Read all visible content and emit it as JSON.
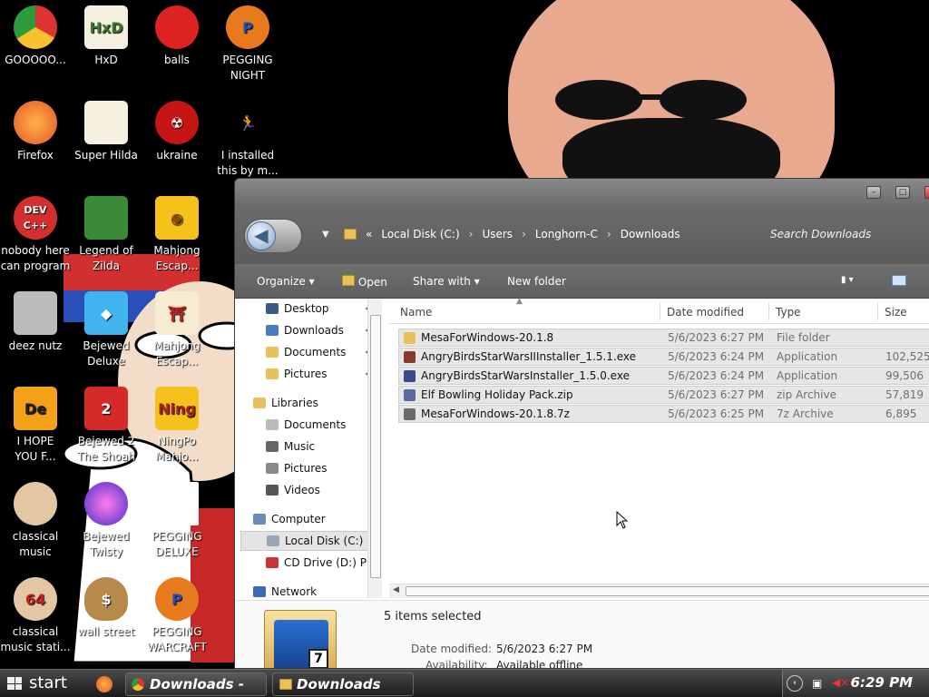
{
  "desktop": {
    "icons": [
      {
        "label": "GOOOOO...",
        "icon": "chrome-icon"
      },
      {
        "label": "HxD",
        "icon": "hxd-icon"
      },
      {
        "label": "balls",
        "icon": "red-fuzzball-icon"
      },
      {
        "label": "PEGGING\nNIGHT",
        "icon": "p-logo-icon"
      },
      {
        "label": "Firefox",
        "icon": "firefox-icon"
      },
      {
        "label": "Super Hilda",
        "icon": "pixel-character-icon"
      },
      {
        "label": "ukraine",
        "icon": "radiation-icon"
      },
      {
        "label": "I installed\nthis by m...",
        "icon": "running-man-icon"
      },
      {
        "label": "nobody here\ncan program",
        "icon": "devcpp-icon"
      },
      {
        "label": "Legend of\nZilda",
        "icon": "elf-character-icon"
      },
      {
        "label": "Mahjong\nEscap...",
        "icon": "mahjong-tile-icon"
      },
      {
        "label": "deez nutz",
        "icon": "windows-stack-icon"
      },
      {
        "label": "Bejewed\nDeluxe",
        "icon": "blue-gem-icon"
      },
      {
        "label": "Mahjong\nEscap...",
        "icon": "torii-tile-icon"
      },
      {
        "label": "I HOPE\nYOU F...",
        "icon": "de-logo-icon"
      },
      {
        "label": "Bejewed 2\nThe Shoah",
        "icon": "diamond-2-icon"
      },
      {
        "label": "NingPo\nMahjo...",
        "icon": "ningpo-tile-icon"
      },
      {
        "label": "classical\nmusic station",
        "icon": "portrait-icon"
      },
      {
        "label": "Bejewed\nTwisty",
        "icon": "gem-orb-icon"
      },
      {
        "label": "PEGGING\nDELUXE",
        "icon": "blank-file-icon"
      },
      {
        "label": "classical\nmusic stati...",
        "icon": "portrait-64-icon"
      },
      {
        "label": "wall street",
        "icon": "money-bag-icon"
      },
      {
        "label": "PEGGING\nWARCRAFT",
        "icon": "p-logo-icon"
      }
    ]
  },
  "window": {
    "breadcrumbs": [
      "Local Disk (C:)",
      "Users",
      "Longhorn-C",
      "Downloads"
    ],
    "breadcrumb_prefix": "«",
    "search_placeholder": "Search Downloads",
    "toolbar": {
      "organize": "Organize",
      "open": "Open",
      "share_with": "Share with",
      "new_folder": "New folder"
    },
    "nav": {
      "favorites": [
        {
          "label": "Desktop"
        },
        {
          "label": "Downloads"
        },
        {
          "label": "Documents"
        },
        {
          "label": "Pictures"
        }
      ],
      "libraries_label": "Libraries",
      "libraries": [
        {
          "label": "Documents"
        },
        {
          "label": "Music"
        },
        {
          "label": "Pictures"
        },
        {
          "label": "Videos"
        }
      ],
      "computer_label": "Computer",
      "drives": [
        {
          "label": "Local Disk (C:)"
        },
        {
          "label": "CD Drive (D:) P"
        }
      ],
      "network_label": "Network"
    },
    "columns": {
      "name": "Name",
      "date": "Date modified",
      "type": "Type",
      "size": "Size"
    },
    "files": [
      {
        "name": "MesaForWindows-20.1.8",
        "date": "5/6/2023 6:27 PM",
        "type": "File folder",
        "size": ""
      },
      {
        "name": "AngryBirdsStarWarsIIInstaller_1.5.1.exe",
        "date": "5/6/2023 6:24 PM",
        "type": "Application",
        "size": "102,525"
      },
      {
        "name": "AngryBirdsStarWarsInstaller_1.5.0.exe",
        "date": "5/6/2023 6:24 PM",
        "type": "Application",
        "size": "99,506"
      },
      {
        "name": "Elf Bowling Holiday Pack.zip",
        "date": "5/6/2023 6:27 PM",
        "type": "zip Archive",
        "size": "57,819"
      },
      {
        "name": "MesaForWindows-20.1.8.7z",
        "date": "5/6/2023 6:25 PM",
        "type": "7z Archive",
        "size": "6,895"
      }
    ],
    "details": {
      "summary": "5 items selected",
      "date_label": "Date modified:",
      "date_value": "5/6/2023 6:27 PM",
      "availability_label": "Availability:",
      "availability_value": "Available offline"
    }
  },
  "taskbar": {
    "start_label": "start",
    "tasks": [
      {
        "label": "Downloads - G..."
      },
      {
        "label": "Downloads"
      }
    ],
    "clock": "6:29 PM"
  },
  "colors": {
    "window_chrome": "#6d6d6d",
    "selection_row": "#e6e6e6",
    "link_blue": "#2a6fcf",
    "folder_yellow": "#e9c15a"
  }
}
